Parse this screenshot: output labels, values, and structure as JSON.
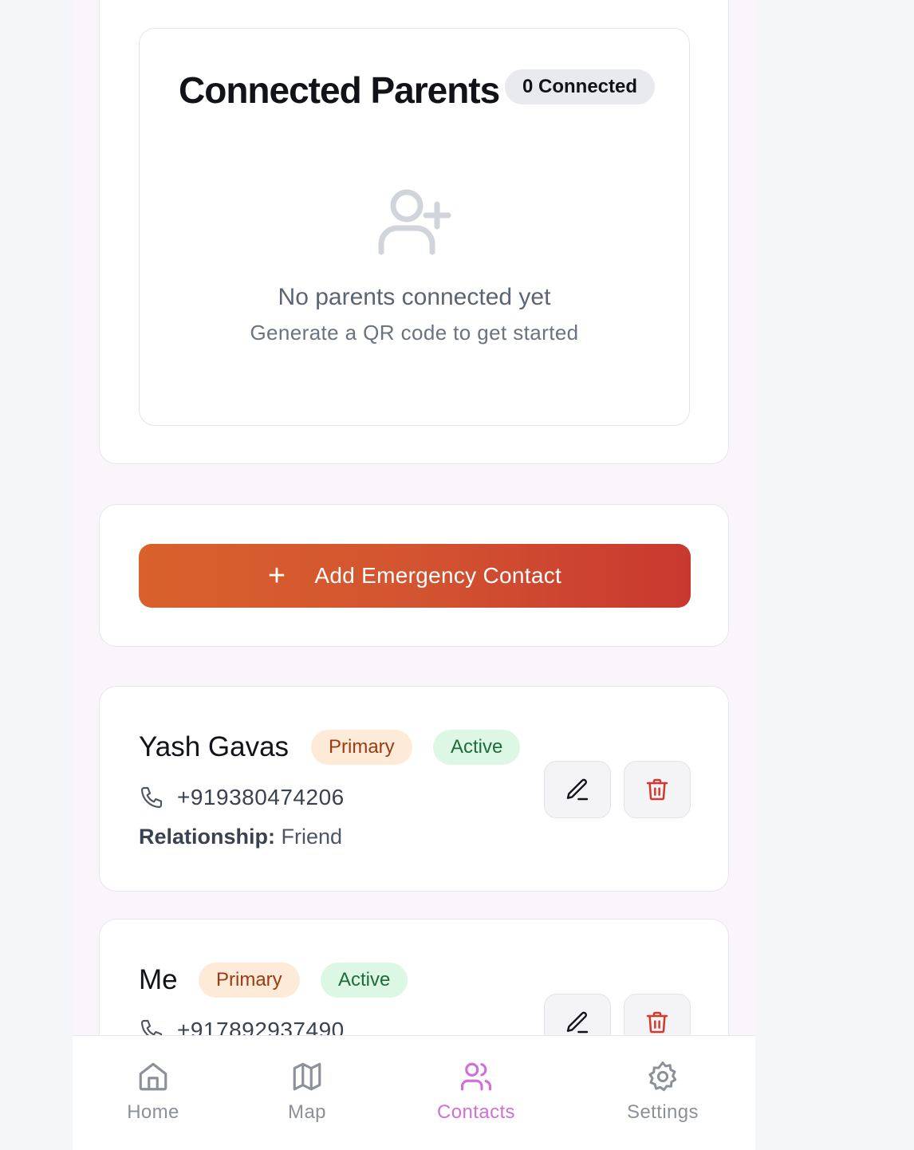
{
  "parents": {
    "title": "Connected Parents",
    "count_badge": "0 Connected",
    "empty_title": "No parents connected yet",
    "empty_subtitle": "Generate a QR code to get started"
  },
  "add_contact": {
    "label": "Add Emergency Contact",
    "plus_icon": "+"
  },
  "contacts": [
    {
      "name": "Yash Gavas",
      "badge_primary": "Primary",
      "badge_active": "Active",
      "phone": "+919380474206",
      "relationship_label": "Relationship:",
      "relationship": "Friend"
    },
    {
      "name": "Me",
      "badge_primary": "Primary",
      "badge_active": "Active",
      "phone": "+917892937490"
    }
  ],
  "nav": {
    "items": [
      {
        "label": "Home",
        "icon": "home-icon"
      },
      {
        "label": "Map",
        "icon": "map-icon"
      },
      {
        "label": "Contacts",
        "icon": "contacts-icon",
        "active": true
      },
      {
        "label": "Settings",
        "icon": "gear-icon"
      }
    ]
  },
  "colors": {
    "accent_gradient_start": "#d9612c",
    "accent_gradient_end": "#c8382f",
    "nav_active": "#d26fd6",
    "delete_red": "#d33a2f",
    "primary_badge_bg": "#fdebd8",
    "active_badge_bg": "#dcf7e3"
  }
}
